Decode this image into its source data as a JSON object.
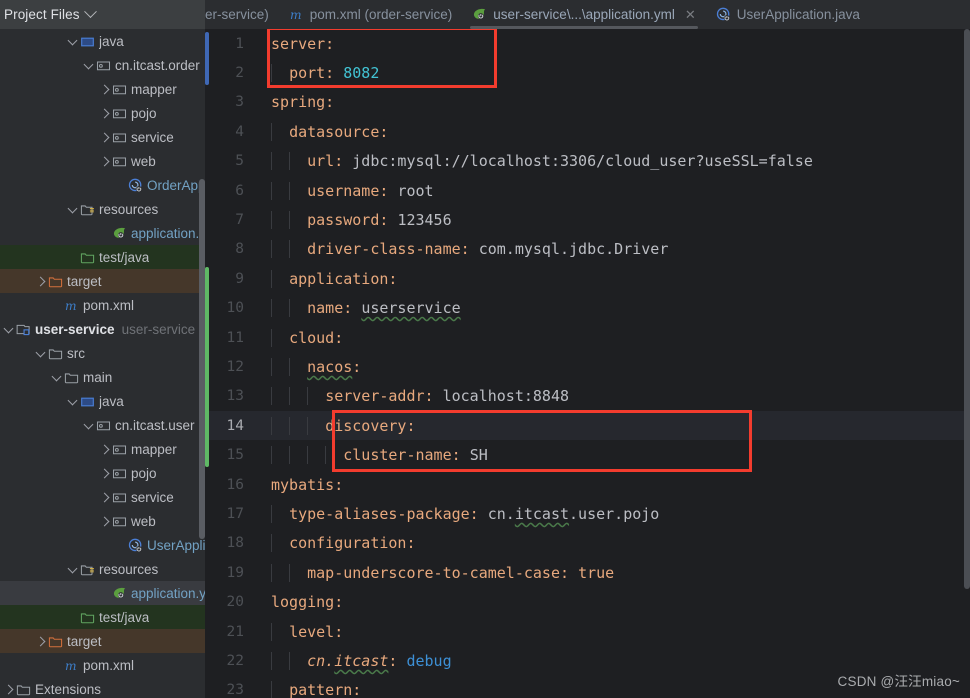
{
  "window": {
    "tool_window_title": "Project Files",
    "watermark": "CSDN @汪汪miao~"
  },
  "colors": {
    "sidebar_bg": "#2b2d30",
    "editor_bg": "#1e1f22",
    "header_bg": "#3c3f41",
    "annotation_red": "#f33c2e",
    "yaml_key": "#e8a97e",
    "yaml_value": "#bcbec4",
    "number_cyan": "#42c3d4",
    "keyword_blue": "#3d90d6",
    "gutter_blue_marker": "#3f68b5",
    "gutter_green_marker": "#5fb865",
    "highlight_green_row": "#23341f",
    "highlight_brown_row": "#45372a"
  },
  "tabs": [
    {
      "label": "er-service)",
      "icon": "clipped-tab",
      "active": false,
      "closable": false,
      "clipped": true
    },
    {
      "label": "pom.xml (order-service)",
      "icon": "maven-m-icon",
      "active": false,
      "closable": false,
      "clipped": false
    },
    {
      "label": "user-service\\...\\application.yml",
      "icon": "spring-leaf-icon",
      "active": true,
      "closable": true,
      "close_label": "✕",
      "clipped": false
    },
    {
      "label": "UserApplication.java",
      "icon": "spring-class-icon",
      "active": false,
      "closable": false,
      "clipped": false
    }
  ],
  "sidebar": {
    "items": [
      {
        "label": "java",
        "sub": "",
        "indent": 4,
        "arrow": "down",
        "icon": "source-root-folder-icon",
        "style": "plain",
        "row_highlight": "none"
      },
      {
        "label": "cn.itcast.order",
        "sub": "",
        "indent": 5,
        "arrow": "down",
        "icon": "package-icon",
        "style": "plain",
        "row_highlight": "none"
      },
      {
        "label": "mapper",
        "sub": "",
        "indent": 6,
        "arrow": "right",
        "icon": "package-icon",
        "style": "plain",
        "row_highlight": "none"
      },
      {
        "label": "pojo",
        "sub": "",
        "indent": 6,
        "arrow": "right",
        "icon": "package-icon",
        "style": "plain",
        "row_highlight": "none"
      },
      {
        "label": "service",
        "sub": "",
        "indent": 6,
        "arrow": "right",
        "icon": "package-icon",
        "style": "plain",
        "row_highlight": "none"
      },
      {
        "label": "web",
        "sub": "",
        "indent": 6,
        "arrow": "right",
        "icon": "package-icon",
        "style": "plain",
        "row_highlight": "none"
      },
      {
        "label": "OrderApplica",
        "sub": "",
        "indent": 7,
        "arrow": "none",
        "icon": "spring-class-icon",
        "style": "blue",
        "row_highlight": "none"
      },
      {
        "label": "resources",
        "sub": "",
        "indent": 4,
        "arrow": "down",
        "icon": "resources-folder-icon",
        "style": "plain",
        "row_highlight": "none"
      },
      {
        "label": "application.yml",
        "sub": "",
        "indent": 6,
        "arrow": "none",
        "icon": "spring-leaf-icon",
        "style": "blue",
        "row_highlight": "none"
      },
      {
        "label": "test/java",
        "sub": "",
        "indent": 4,
        "arrow": "none",
        "icon": "test-folder-icon",
        "style": "plain",
        "row_highlight": "green"
      },
      {
        "label": "target",
        "sub": "",
        "indent": 2,
        "arrow": "right",
        "icon": "excluded-folder-icon",
        "style": "plain",
        "row_highlight": "brown"
      },
      {
        "label": "pom.xml",
        "sub": "",
        "indent": 3,
        "arrow": "none",
        "icon": "maven-m-icon",
        "style": "plain",
        "row_highlight": "none"
      },
      {
        "label": "user-service",
        "sub": "user-service",
        "indent": 0,
        "arrow": "down",
        "icon": "module-icon",
        "style": "bold",
        "row_highlight": "none"
      },
      {
        "label": "src",
        "sub": "",
        "indent": 2,
        "arrow": "down",
        "icon": "folder-icon",
        "style": "plain",
        "row_highlight": "none"
      },
      {
        "label": "main",
        "sub": "",
        "indent": 3,
        "arrow": "down",
        "icon": "folder-icon",
        "style": "plain",
        "row_highlight": "none"
      },
      {
        "label": "java",
        "sub": "",
        "indent": 4,
        "arrow": "down",
        "icon": "source-root-folder-icon",
        "style": "plain",
        "row_highlight": "none"
      },
      {
        "label": "cn.itcast.user",
        "sub": "",
        "indent": 5,
        "arrow": "down",
        "icon": "package-icon",
        "style": "plain",
        "row_highlight": "none"
      },
      {
        "label": "mapper",
        "sub": "",
        "indent": 6,
        "arrow": "right",
        "icon": "package-icon",
        "style": "plain",
        "row_highlight": "none"
      },
      {
        "label": "pojo",
        "sub": "",
        "indent": 6,
        "arrow": "right",
        "icon": "package-icon",
        "style": "plain",
        "row_highlight": "none"
      },
      {
        "label": "service",
        "sub": "",
        "indent": 6,
        "arrow": "right",
        "icon": "package-icon",
        "style": "plain",
        "row_highlight": "none"
      },
      {
        "label": "web",
        "sub": "",
        "indent": 6,
        "arrow": "right",
        "icon": "package-icon",
        "style": "plain",
        "row_highlight": "none"
      },
      {
        "label": "UserApplica",
        "sub": "",
        "indent": 7,
        "arrow": "none",
        "icon": "spring-class-icon",
        "style": "blue",
        "row_highlight": "none"
      },
      {
        "label": "resources",
        "sub": "",
        "indent": 4,
        "arrow": "down",
        "icon": "resources-folder-icon",
        "style": "plain",
        "row_highlight": "none"
      },
      {
        "label": "application.yml",
        "sub": "",
        "indent": 6,
        "arrow": "none",
        "icon": "spring-leaf-icon",
        "style": "blue",
        "row_highlight": "selected"
      },
      {
        "label": "test/java",
        "sub": "",
        "indent": 4,
        "arrow": "none",
        "icon": "test-folder-icon",
        "style": "plain",
        "row_highlight": "green"
      },
      {
        "label": "target",
        "sub": "",
        "indent": 2,
        "arrow": "right",
        "icon": "excluded-folder-icon",
        "style": "plain",
        "row_highlight": "brown"
      },
      {
        "label": "pom.xml",
        "sub": "",
        "indent": 3,
        "arrow": "none",
        "icon": "maven-m-icon",
        "style": "plain",
        "row_highlight": "none"
      },
      {
        "label": "Extensions",
        "sub": "",
        "indent": 0,
        "arrow": "right",
        "icon": "folder-icon",
        "style": "plain",
        "row_highlight": "none"
      }
    ]
  },
  "editor": {
    "file": "application.yml",
    "current_line": 14,
    "lines": [
      {
        "n": 1,
        "indent": 0,
        "tokens": [
          {
            "t": "server:",
            "c": "k"
          }
        ]
      },
      {
        "n": 2,
        "indent": 1,
        "tokens": [
          {
            "t": "port: ",
            "c": "k"
          },
          {
            "t": "8082",
            "c": "num"
          }
        ]
      },
      {
        "n": 3,
        "indent": 0,
        "tokens": [
          {
            "t": "spring:",
            "c": "k"
          }
        ]
      },
      {
        "n": 4,
        "indent": 1,
        "tokens": [
          {
            "t": "datasource:",
            "c": "k"
          }
        ]
      },
      {
        "n": 5,
        "indent": 2,
        "tokens": [
          {
            "t": "url: ",
            "c": "k"
          },
          {
            "t": "jdbc:mysql://localhost:3306/cloud_user?useSSL=false",
            "c": "v"
          }
        ]
      },
      {
        "n": 6,
        "indent": 2,
        "tokens": [
          {
            "t": "username: ",
            "c": "k"
          },
          {
            "t": "root",
            "c": "v"
          }
        ]
      },
      {
        "n": 7,
        "indent": 2,
        "tokens": [
          {
            "t": "password: ",
            "c": "k"
          },
          {
            "t": "123456",
            "c": "v"
          }
        ]
      },
      {
        "n": 8,
        "indent": 2,
        "tokens": [
          {
            "t": "driver-class-name: ",
            "c": "k"
          },
          {
            "t": "com.mysql.jdbc.Driver",
            "c": "v"
          }
        ]
      },
      {
        "n": 9,
        "indent": 1,
        "tokens": [
          {
            "t": "application:",
            "c": "k"
          }
        ]
      },
      {
        "n": 10,
        "indent": 2,
        "tokens": [
          {
            "t": "name: ",
            "c": "k"
          },
          {
            "t": "userservice",
            "c": "v wavy"
          }
        ]
      },
      {
        "n": 11,
        "indent": 1,
        "tokens": [
          {
            "t": "cloud:",
            "c": "k"
          }
        ]
      },
      {
        "n": 12,
        "indent": 2,
        "tokens": [
          {
            "t": "nacos",
            "c": "k wavy"
          },
          {
            "t": ":",
            "c": "k"
          }
        ]
      },
      {
        "n": 13,
        "indent": 3,
        "tokens": [
          {
            "t": "server-addr: ",
            "c": "k"
          },
          {
            "t": "localhost:8848",
            "c": "v"
          }
        ]
      },
      {
        "n": 14,
        "indent": 3,
        "tokens": [
          {
            "t": "discovery:",
            "c": "k"
          }
        ]
      },
      {
        "n": 15,
        "indent": 4,
        "tokens": [
          {
            "t": "cluster-name: ",
            "c": "k"
          },
          {
            "t": "SH",
            "c": "v"
          }
        ]
      },
      {
        "n": 16,
        "indent": 0,
        "tokens": [
          {
            "t": "mybatis:",
            "c": "k"
          }
        ]
      },
      {
        "n": 17,
        "indent": 1,
        "tokens": [
          {
            "t": "type-aliases-package: ",
            "c": "k"
          },
          {
            "t": "cn.",
            "c": "v"
          },
          {
            "t": "itcast",
            "c": "v wavy"
          },
          {
            "t": ".user.pojo",
            "c": "v"
          }
        ]
      },
      {
        "n": 18,
        "indent": 1,
        "tokens": [
          {
            "t": "configuration:",
            "c": "k"
          }
        ]
      },
      {
        "n": 19,
        "indent": 2,
        "tokens": [
          {
            "t": "map-underscore-to-camel-case: ",
            "c": "k"
          },
          {
            "t": "true",
            "c": "kw"
          }
        ]
      },
      {
        "n": 20,
        "indent": 0,
        "tokens": [
          {
            "t": "logging:",
            "c": "k"
          }
        ]
      },
      {
        "n": 21,
        "indent": 1,
        "tokens": [
          {
            "t": "level:",
            "c": "k"
          }
        ]
      },
      {
        "n": 22,
        "indent": 2,
        "tokens": [
          {
            "t": "cn.",
            "c": "ital"
          },
          {
            "t": "itcast",
            "c": "ital wavy"
          },
          {
            "t": ": ",
            "c": "k"
          },
          {
            "t": "debug",
            "c": "blu"
          }
        ]
      },
      {
        "n": 23,
        "indent": 1,
        "tokens": [
          {
            "t": "pattern:",
            "c": "k"
          }
        ]
      }
    ],
    "gutter_markers": [
      {
        "kind": "blue",
        "from_line": 1,
        "to_line": 2
      },
      {
        "kind": "green",
        "from_line": 9,
        "to_line": 15
      }
    ],
    "annotations": [
      {
        "name": "server-port-highlight",
        "from_line": 1,
        "to_line": 2,
        "label": ""
      },
      {
        "name": "nacos-discovery-highlight",
        "from_line": 14,
        "to_line": 15,
        "label": ""
      }
    ]
  }
}
